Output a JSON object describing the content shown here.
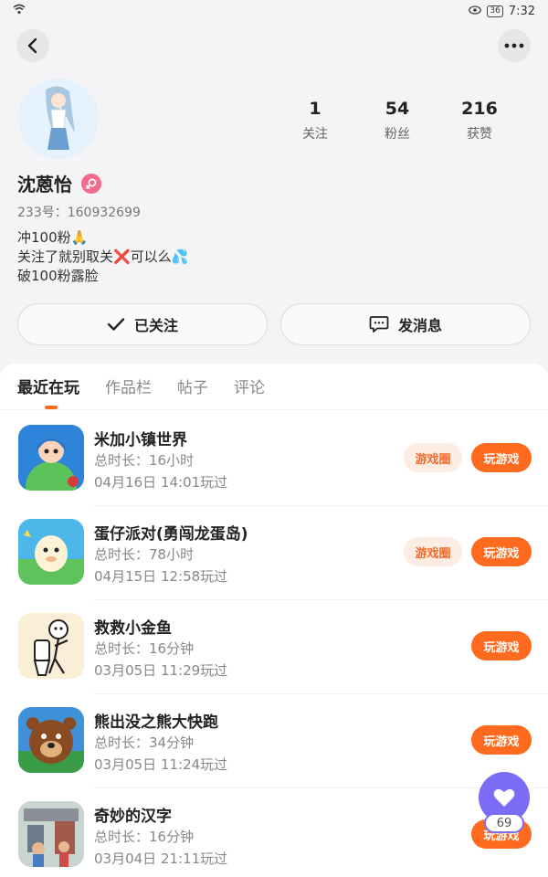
{
  "status_bar": {
    "battery": "36",
    "time": "7:32"
  },
  "profile": {
    "name": "沈蒽怡",
    "uid": "233号：160932699",
    "bio": [
      "冲100粉🙏",
      "关注了就别取关❌可以么💦",
      "破100粉露脸"
    ],
    "stats": [
      {
        "value": "1",
        "label": "关注"
      },
      {
        "value": "54",
        "label": "粉丝"
      },
      {
        "value": "216",
        "label": "获赞"
      }
    ]
  },
  "actions": {
    "follow": "已关注",
    "message": "发消息"
  },
  "tabs": [
    "最近在玩",
    "作品栏",
    "帖子",
    "评论"
  ],
  "games": [
    {
      "title": "米加小镇世界",
      "duration": "总时长：16小时",
      "played": "04月16日 14:01玩过",
      "circle": "游戏圈",
      "play": "玩游戏"
    },
    {
      "title": "蛋仔派对(勇闯龙蛋岛)",
      "duration": "总时长：78小时",
      "played": "04月15日 12:58玩过",
      "circle": "游戏圈",
      "play": "玩游戏"
    },
    {
      "title": "救救小金鱼",
      "duration": "总时长：16分钟",
      "played": "03月05日 11:29玩过",
      "play": "玩游戏"
    },
    {
      "title": "熊出没之熊大快跑",
      "duration": "总时长：34分钟",
      "played": "03月05日 11:24玩过",
      "play": "玩游戏"
    },
    {
      "title": "奇妙的汉字",
      "duration": "总时长：16分钟",
      "played": "03月04日 21:11玩过",
      "play": "玩游戏"
    }
  ],
  "fab": {
    "count": "69"
  },
  "colors": {
    "accent": "#ff6a1f",
    "fab": "#7b6cf6",
    "gender": "#f46a8d"
  }
}
